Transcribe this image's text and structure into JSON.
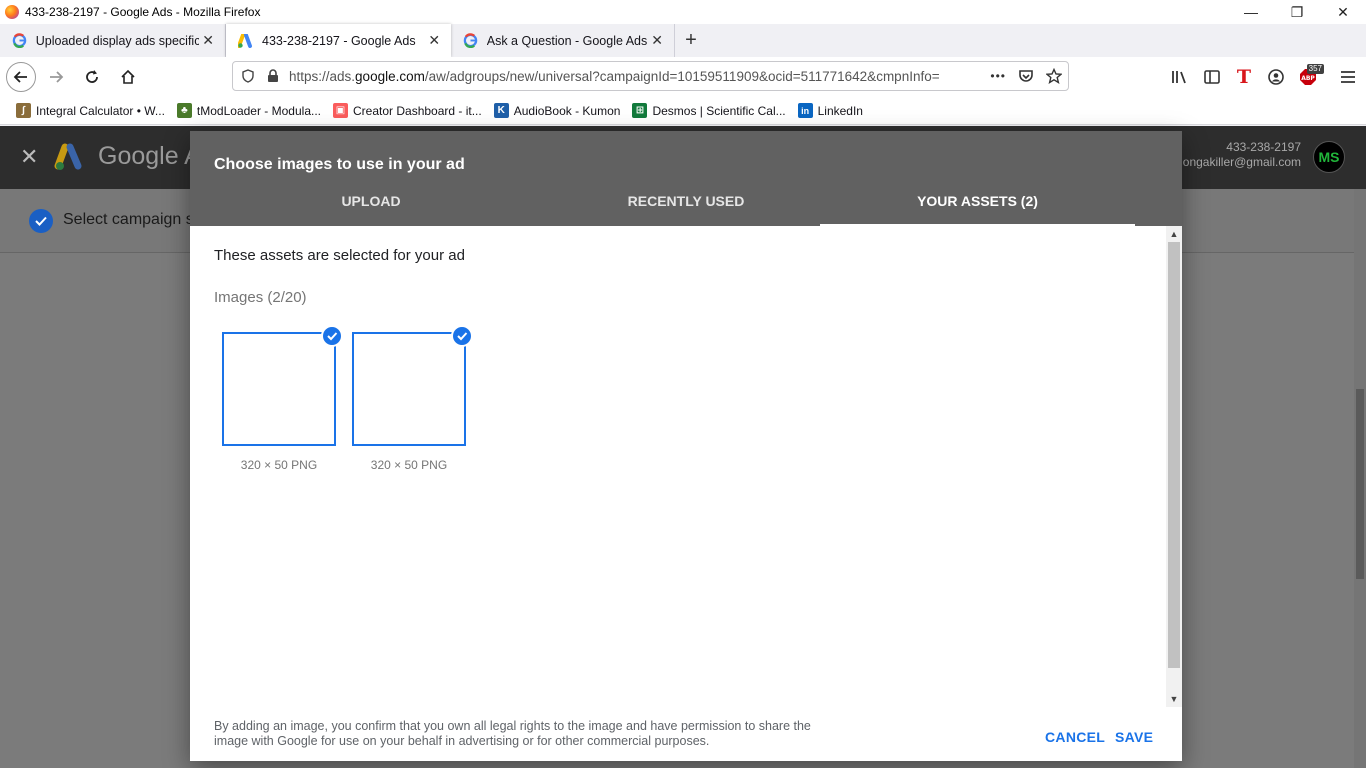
{
  "window": {
    "title": "433-238-2197 - Google Ads - Mozilla Firefox",
    "minimize": "—",
    "restore": "❐",
    "close": "✕"
  },
  "tabs": [
    {
      "label": "Uploaded display ads specificat",
      "icon": "google-g-icon",
      "active": false
    },
    {
      "label": "433-238-2197 - Google Ads",
      "icon": "google-ads-icon",
      "active": true
    },
    {
      "label": "Ask a Question - Google Ads C",
      "icon": "google-g-icon",
      "active": false
    }
  ],
  "tab_close": "✕",
  "new_tab": "+",
  "urlbar": {
    "prefix": "https://ads.",
    "host": "google.com",
    "path": "/aw/adgroups/new/universal?campaignId=10159511909&ocid=511771642&cmpnInfo=",
    "more": "•••"
  },
  "toolbar": {
    "abp_count": "357"
  },
  "bookmarks": [
    {
      "label": "Integral Calculator • W...",
      "icon": "integral-icon",
      "color": "#8a6d3b",
      "glyph": "∫"
    },
    {
      "label": "tModLoader - Modula...",
      "icon": "tree-icon",
      "color": "#4a7a2a",
      "glyph": "♣"
    },
    {
      "label": "Creator Dashboard - it...",
      "icon": "itch-icon",
      "color": "#fa5c5c",
      "glyph": "▣"
    },
    {
      "label": "AudioBook - Kumon",
      "icon": "kumon-icon",
      "color": "#1f5fa8",
      "glyph": "K"
    },
    {
      "label": "Desmos | Scientific Cal...",
      "icon": "desmos-icon",
      "color": "#127a3c",
      "glyph": "⊞"
    },
    {
      "label": "LinkedIn",
      "icon": "linkedin-icon",
      "color": "#0a66c2",
      "glyph": "in"
    }
  ],
  "ga": {
    "close": "✕",
    "title": "Google A",
    "account_number": "433-238-2197",
    "account_email": "ongakiller@gmail.com",
    "avatar": "MS",
    "step_text": "Select campaign se"
  },
  "dialog": {
    "title": "Choose images to use in your ad",
    "tabs": [
      "UPLOAD",
      "RECENTLY USED",
      "YOUR ASSETS (2)"
    ],
    "active_tab": 2,
    "heading": "These assets are selected for your ad",
    "images_count": "Images (2/20)",
    "assets": [
      {
        "caption": "320 × 50 PNG",
        "selected": true
      },
      {
        "caption": "320 × 50 PNG",
        "selected": true
      }
    ],
    "legal": "By adding an image, you confirm that you own all legal rights to the image and have permission to share the image with Google for use on your behalf in advertising or for other commercial purposes.",
    "cancel": "CANCEL",
    "save": "SAVE"
  },
  "colors": {
    "accent": "#1a73e8",
    "dialog_header": "#616161",
    "page_header": "#2d2d2d"
  }
}
